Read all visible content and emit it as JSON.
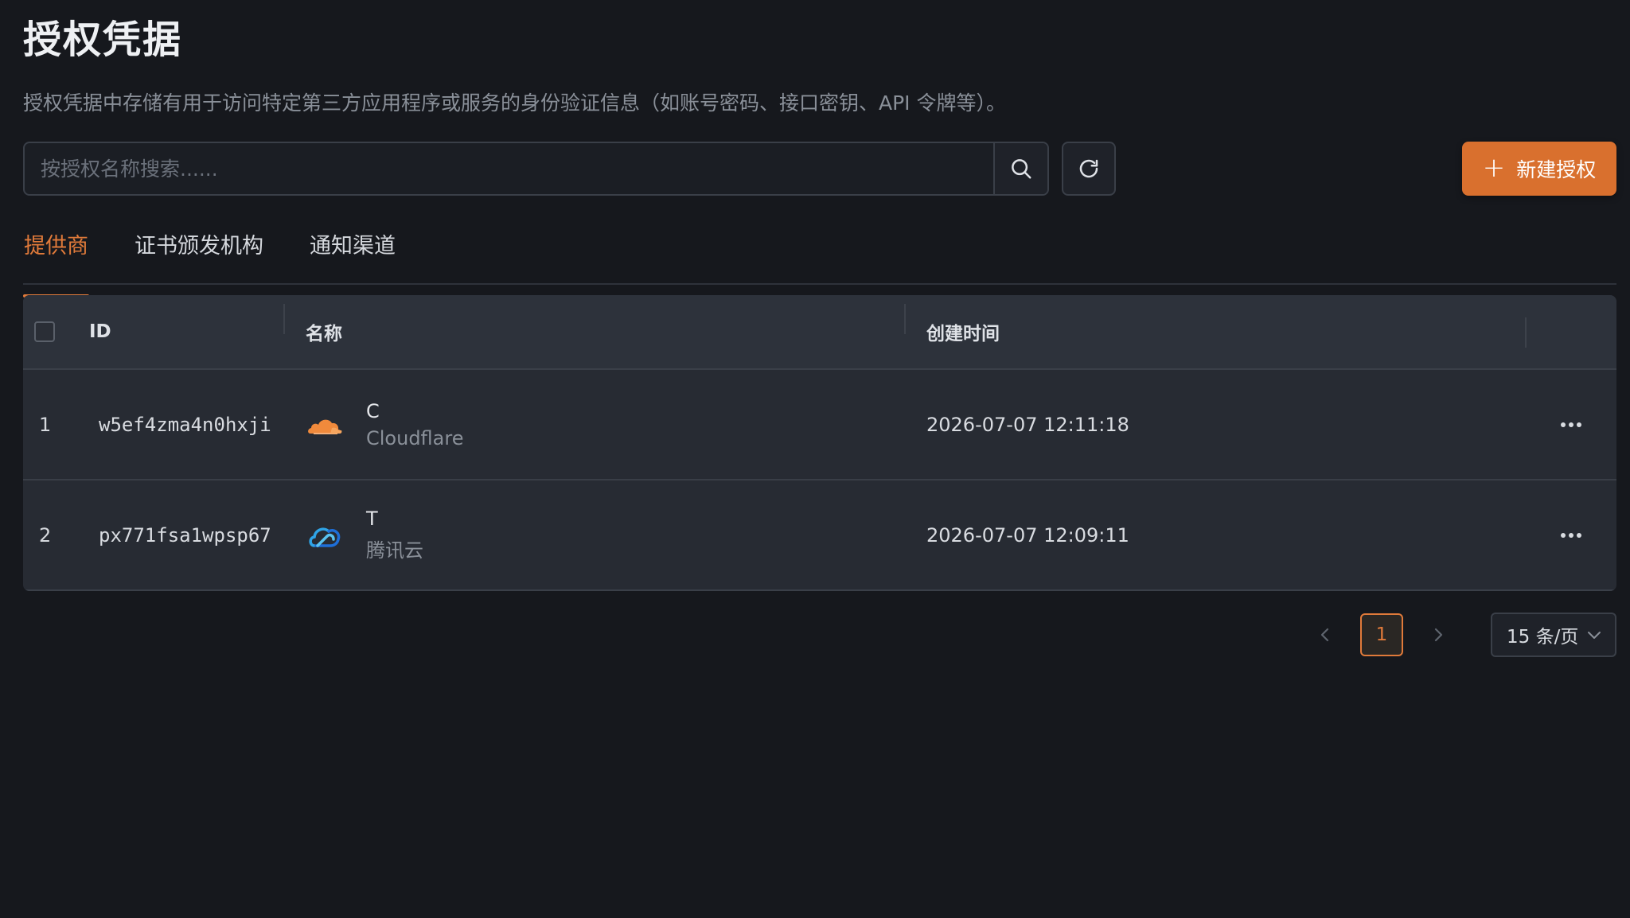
{
  "page": {
    "title": "授权凭据",
    "description": "授权凭据中存储有用于访问特定第三方应用程序或服务的身份验证信息（如账号密码、接口密钥、API 令牌等）。"
  },
  "toolbar": {
    "search_placeholder": "按授权名称搜索......",
    "search_value": "",
    "search_icon": "search-icon",
    "refresh_icon": "refresh-icon",
    "new_button_label": "新建授权",
    "new_button_icon": "plus-icon",
    "accent_color": "#d9702e"
  },
  "tabs": [
    {
      "label": "提供商",
      "active": true
    },
    {
      "label": "证书颁发机构",
      "active": false
    },
    {
      "label": "通知渠道",
      "active": false
    }
  ],
  "table": {
    "headers": {
      "id": "ID",
      "name": "名称",
      "created": "创建时间"
    },
    "rows": [
      {
        "index": "1",
        "id": "w5ef4zma4n0hxji",
        "icon": "cloudflare-icon",
        "name": "C",
        "provider": "Cloudflare",
        "created": "2026-07-07 12:11:18"
      },
      {
        "index": "2",
        "id": "px771fsa1wpsp67",
        "icon": "tencent-cloud-icon",
        "name": "T",
        "provider": "腾讯云",
        "created": "2026-07-07 12:09:11"
      }
    ]
  },
  "pagination": {
    "current_page": "1",
    "page_size": "15 条/页"
  }
}
